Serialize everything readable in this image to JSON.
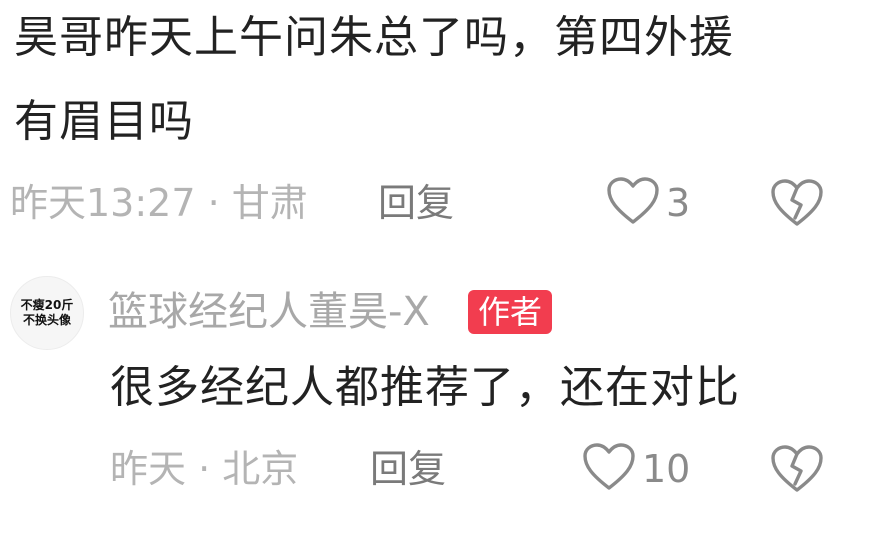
{
  "comment": {
    "line1": "昊哥昨天上午问朱总了吗，第四外援",
    "line2": "有眉目吗",
    "meta": "昨天13:27 · 甘肃",
    "reply_label": "回复",
    "like_count": "3"
  },
  "reply": {
    "avatar_line1": "不瘦20斤",
    "avatar_line2": "不换头像",
    "username": "篮球经纪人董昊-X",
    "badge": "作者",
    "text": "很多经纪人都推荐了，还在对比",
    "meta": "昨天 · 北京",
    "reply_label": "回复",
    "like_count": "10"
  },
  "icons": {
    "like": "heart-outline-icon",
    "dislike": "broken-heart-icon"
  },
  "colors": {
    "badge": "#f23d4f",
    "meta_text": "#b4b4b4",
    "icon_stroke": "#8a8a8a"
  }
}
